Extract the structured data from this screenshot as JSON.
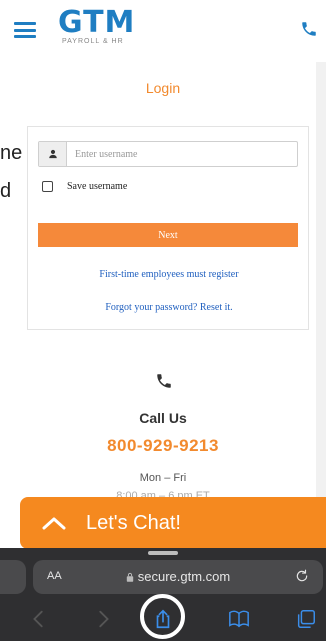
{
  "header": {
    "logo_text": "GTM",
    "logo_tm": "™",
    "logo_sub": "PAYROLL & HR"
  },
  "side_fragments": [
    "ne",
    "d"
  ],
  "login": {
    "title": "Login",
    "username_placeholder": "Enter username",
    "save_label": "Save username",
    "next_label": "Next",
    "register_link": "First-time employees must register",
    "forgot_link": "Forgot your password? Reset it."
  },
  "contact": {
    "call_us": "Call Us",
    "phone_number": "800-929-9213",
    "hours": "Mon – Fri",
    "hours_partial": "8:00 am – 6 pm ET"
  },
  "chat": {
    "label": "Let's Chat!"
  },
  "browser": {
    "text_size_label": "AA",
    "url": "secure.gtm.com"
  },
  "colors": {
    "brand_blue": "#1f7ec2",
    "brand_orange": "#f5891f",
    "link_blue": "#1f5fbf"
  },
  "icons": {
    "menu": "hamburger-icon",
    "phone": "phone-icon",
    "user": "user-icon",
    "chat": "chevron-up-icon",
    "lock": "lock-icon",
    "reload": "reload-icon",
    "back": "back-icon",
    "forward": "forward-icon",
    "share": "share-icon",
    "bookmarks": "bookmarks-icon",
    "tabs": "tabs-icon"
  }
}
